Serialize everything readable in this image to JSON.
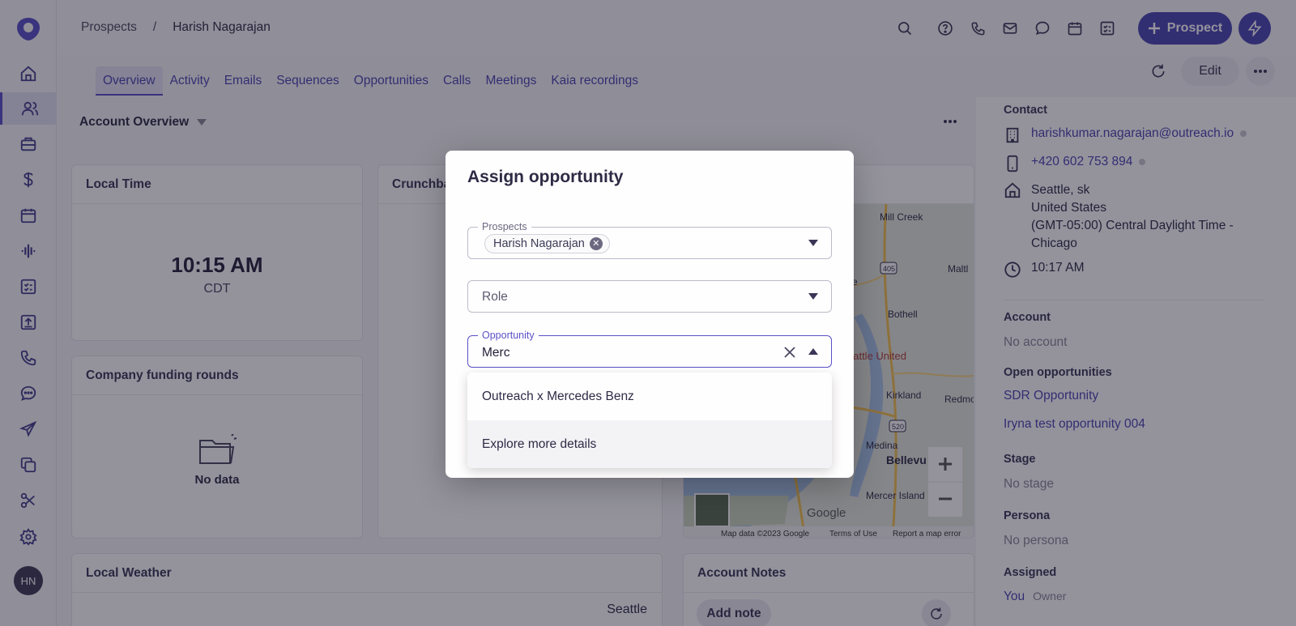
{
  "breadcrumb": {
    "parent": "Prospects",
    "separator": "/",
    "current": "Harish Nagarajan"
  },
  "header": {
    "prospect_button": "Prospect"
  },
  "tabs": [
    "Overview",
    "Activity",
    "Emails",
    "Sequences",
    "Opportunities",
    "Calls",
    "Meetings",
    "Kaia recordings"
  ],
  "actions": {
    "edit": "Edit"
  },
  "account_overview": {
    "title": "Account Overview"
  },
  "cards": {
    "local_time": {
      "title": "Local Time",
      "time": "10:15 AM",
      "tz": "CDT"
    },
    "crunchbase": {
      "title": "Crunchba"
    },
    "funding": {
      "title": "Company funding rounds",
      "empty": "No data"
    },
    "weather": {
      "title": "Local Weather",
      "city": "Seattle"
    },
    "notes": {
      "title": "Account Notes",
      "add": "Add note"
    },
    "map": {
      "labels": [
        "Mill Creek",
        "Maltl",
        "ke",
        "Bothell",
        "eattle United",
        "Kirkland",
        "Redmo",
        "Medina",
        "Bellevu",
        "Mercer Island"
      ],
      "shields": [
        "405",
        "520"
      ],
      "google": "Google",
      "footer": [
        "Map data ©2023 Google",
        "Terms of Use",
        "Report a map error"
      ]
    }
  },
  "contact": {
    "title": "Contact",
    "email": "harishkumar.nagarajan@outreach.io",
    "phone": "+420 602 753 894",
    "address": [
      "Seattle, sk",
      "United States",
      "(GMT-05:00) Central Daylight Time -",
      "Chicago"
    ],
    "local_time": "10:17 AM"
  },
  "account": {
    "title": "Account",
    "value": "No account"
  },
  "open_opportunities": {
    "title": "Open opportunities",
    "items": [
      "SDR Opportunity",
      "Iryna test opportunity 004"
    ]
  },
  "stage": {
    "title": "Stage",
    "value": "No stage"
  },
  "persona": {
    "title": "Persona",
    "value": "No persona"
  },
  "assigned": {
    "title": "Assigned",
    "value": "You",
    "role": "Owner"
  },
  "user": {
    "initials": "HN"
  },
  "modal": {
    "title": "Assign opportunity",
    "prospects": {
      "label": "Prospects",
      "chip": "Harish Nagarajan"
    },
    "role": {
      "placeholder": "Role"
    },
    "opportunity": {
      "label": "Opportunity",
      "value": "Merc"
    },
    "options": [
      "Outreach x Mercedes Benz",
      "Explore more details"
    ]
  }
}
